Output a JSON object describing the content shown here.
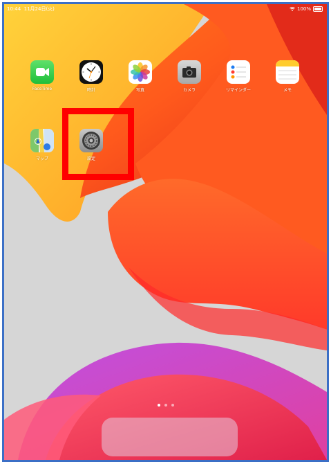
{
  "status_bar": {
    "time": "10:44",
    "date": "11月24日(火)",
    "battery_percent": "100%",
    "wifi_icon": "wifi-icon",
    "battery_icon": "battery-icon"
  },
  "apps": [
    {
      "label": "FaceTime",
      "icon": "facetime-icon"
    },
    {
      "label": "時計",
      "icon": "clock-icon"
    },
    {
      "label": "写真",
      "icon": "photos-icon"
    },
    {
      "label": "カメラ",
      "icon": "camera-icon"
    },
    {
      "label": "リマインダー",
      "icon": "reminders-icon"
    },
    {
      "label": "メモ",
      "icon": "notes-icon"
    },
    {
      "label": "マップ",
      "icon": "maps-icon"
    },
    {
      "label": "設定",
      "icon": "settings-icon"
    }
  ],
  "page_indicator": {
    "pages": 3,
    "current": 1
  },
  "highlight": {
    "target": "設定",
    "color": "#ff0000"
  },
  "frame_color": "#3b6fc6"
}
